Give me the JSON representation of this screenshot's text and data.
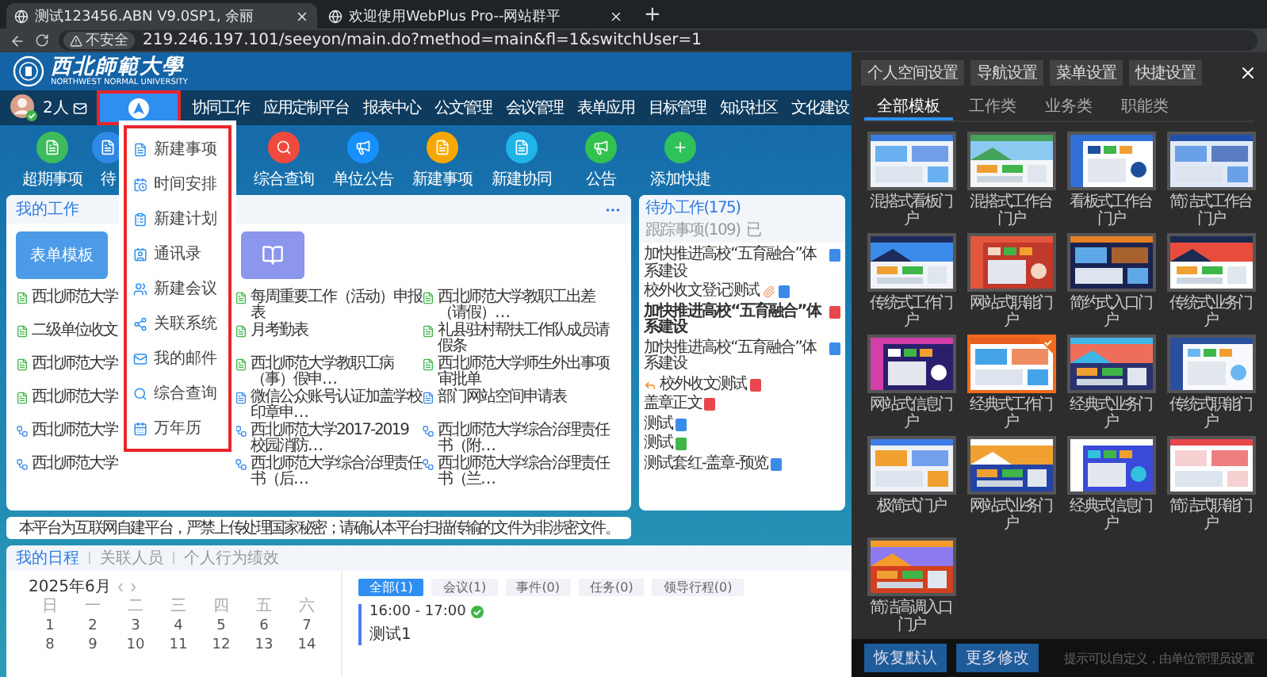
{
  "browser": {
    "tabs": [
      {
        "title": "测试123456.ABN V9.0SP1, 余丽",
        "selected": true
      },
      {
        "title": "欢迎使用WebPlus Pro--网站群平",
        "selected": false
      }
    ],
    "new_tab": "+",
    "security": "不安全",
    "url": "219.246.197.101/seeyon/main.do?method=main&fl=1&switchUser=1"
  },
  "header": {
    "logo_title": "西北師範大學",
    "logo_subtitle": "NORTHWEST NORMAL UNIVERSITY"
  },
  "user": {
    "online": "2人"
  },
  "nav": [
    {
      "kind": "home",
      "selected": true
    },
    {
      "kind": "text",
      "label": "协同工作",
      "selected": false
    },
    {
      "kind": "text",
      "label": "应用定制平台",
      "selected": false
    },
    {
      "kind": "text",
      "label": "报表中心",
      "selected": false
    },
    {
      "kind": "text",
      "label": "公文管理",
      "selected": false
    },
    {
      "kind": "text",
      "label": "会议管理",
      "selected": false
    },
    {
      "kind": "text",
      "label": "表单应用",
      "selected": false
    },
    {
      "kind": "text",
      "label": "目标管理",
      "selected": false
    },
    {
      "kind": "text",
      "label": "知识社区",
      "selected": false
    },
    {
      "kind": "text",
      "label": "文化建设",
      "selected": false
    }
  ],
  "dropdown": [
    {
      "label": "新建事项",
      "kind": "doc"
    },
    {
      "label": "时间安排",
      "kind": "schedule"
    },
    {
      "label": "新建计划",
      "kind": "plan"
    },
    {
      "label": "通讯录",
      "kind": "contacts"
    },
    {
      "label": "新建会议",
      "kind": "meeting"
    },
    {
      "label": "关联系统",
      "kind": "system"
    },
    {
      "label": "我的邮件",
      "kind": "mail"
    },
    {
      "label": "综合查询",
      "kind": "search"
    },
    {
      "label": "万年历",
      "kind": "calendar"
    }
  ],
  "shortcuts": [
    {
      "label": "超期事项",
      "color": "#3dbb5d",
      "kind": "doc"
    },
    {
      "label": "待",
      "color": "#2e8ae6",
      "kind": "doc"
    },
    {
      "label": "综合查询",
      "color": "#f04a3c",
      "kind": "search"
    },
    {
      "label": "单位公告",
      "color": "#1890ff",
      "kind": "speaker"
    },
    {
      "label": "新建事项",
      "color": "#f7a800",
      "kind": "doc"
    },
    {
      "label": "新建协同",
      "color": "#1fb5e8",
      "kind": "doc"
    },
    {
      "label": "公告",
      "color": "#33c24d",
      "kind": "speaker"
    },
    {
      "label": "添加快捷",
      "color": "#2fc25b",
      "kind": "plus"
    }
  ],
  "my_work": {
    "title": "我的工作",
    "template_tile": "表单模板",
    "columns": [
      [
        {
          "text": "西北师范大学",
          "kind": "form"
        },
        {
          "text": "二级单位收文",
          "kind": "form"
        },
        {
          "text": "西北师范大学",
          "kind": "form"
        },
        {
          "text": "西北师范大学",
          "kind": "form"
        },
        {
          "text": "西北师范大学",
          "kind": "flow"
        },
        {
          "text": "西北师范大学",
          "kind": "flow"
        }
      ],
      [
        {
          "text": "每周重要工作（活动）申报表",
          "kind": "form"
        },
        {
          "text": "月考勤表",
          "kind": "form"
        },
        {
          "text": "西北师范大学教职工病（事）假申…",
          "kind": "form"
        },
        {
          "text": "微信公众账号认证加盖学校印章申…",
          "kind": "doc"
        },
        {
          "text": "西北师范大学2017-2019校园消防…",
          "kind": "flow"
        },
        {
          "text": "西北师范大学综合治理责任书（后…",
          "kind": "flow"
        }
      ],
      [
        {
          "text": "西北师范大学教职工出差（请假）…",
          "kind": "form"
        },
        {
          "text": "礼县驻村帮扶工作队成员请假条",
          "kind": "form"
        },
        {
          "text": "西北师范大学师生外出事项审批单",
          "kind": "form"
        },
        {
          "text": "部门网站空间申请表",
          "kind": "doc"
        },
        {
          "text": "西北师范大学综合治理责任书（附…",
          "kind": "flow"
        },
        {
          "text": "西北师范大学综合治理责任书（兰…",
          "kind": "flow"
        }
      ]
    ]
  },
  "todo": {
    "tabs": [
      {
        "label": "待办工作(175)",
        "selected": true
      },
      {
        "label": "跟踪事项(109)",
        "selected": false
      },
      {
        "label": "已",
        "selected": false
      }
    ],
    "items": [
      {
        "text": "加快推进高校“五育融合”体系建设",
        "bold": false,
        "kind": "plain",
        "color": "#3b8beb"
      },
      {
        "text": "校外收文登记测试",
        "bold": false,
        "kind": "attachment",
        "color": "#3b8beb"
      },
      {
        "text": "加快推进高校“五育融合”体系建设",
        "bold": true,
        "kind": "plain",
        "color": "#e8474c"
      },
      {
        "text": "加快推进高校“五育融合”体系建设",
        "bold": false,
        "kind": "plain",
        "color": "#3b8beb"
      },
      {
        "text": "校外收文测试",
        "bold": false,
        "kind": "reply",
        "color": "#e8474c"
      },
      {
        "text": "盖章正文",
        "bold": false,
        "kind": "plain",
        "color": "#e8474c"
      },
      {
        "text": "测试",
        "bold": false,
        "kind": "plain",
        "color": "#3b8beb"
      },
      {
        "text": "测试",
        "bold": false,
        "kind": "plain",
        "color": "#3fb54a"
      },
      {
        "text": "测试套红-盖章-预览",
        "bold": false,
        "kind": "plain",
        "color": "#3b8beb"
      }
    ]
  },
  "notice": "本平台为互联网自建平台，严禁上传处理国家秘密；请确认本平台扫描传输的文件为非涉密文件。",
  "schedule": {
    "tabs": [
      {
        "label": "我的日程",
        "selected": true
      },
      {
        "label": "关联人员",
        "selected": false
      },
      {
        "label": "个人行为绩效",
        "selected": false
      }
    ],
    "month": "2025年6月",
    "weekdays": [
      "日",
      "一",
      "二",
      "三",
      "四",
      "五",
      "六"
    ],
    "weeks": [
      [
        "1",
        "2",
        "3",
        "4",
        "5",
        "6",
        "7"
      ],
      [
        "8",
        "9",
        "10",
        "11",
        "12",
        "13",
        "14"
      ]
    ],
    "filters": [
      {
        "label": "全部(1)",
        "selected": true
      },
      {
        "label": "会议(1)",
        "selected": false
      },
      {
        "label": "事件(0)",
        "selected": false
      },
      {
        "label": "任务(0)",
        "selected": false
      },
      {
        "label": "领导行程(0)",
        "selected": false
      }
    ],
    "events": [
      {
        "time": "16:00 - 17:00",
        "done": true,
        "title": "测试1"
      }
    ]
  },
  "drawer": {
    "settings": [
      "个人空间设置",
      "导航设置",
      "菜单设置",
      "快捷设置"
    ],
    "tabs": [
      {
        "label": "全部模板",
        "selected": true
      },
      {
        "label": "工作类",
        "selected": false
      },
      {
        "label": "业务类",
        "selected": false
      },
      {
        "label": "职能类",
        "selected": false
      }
    ],
    "portals": [
      {
        "label": "混搭式看板门户",
        "selected": false
      },
      {
        "label": "混搭式工作台门户",
        "selected": false
      },
      {
        "label": "看板式工作台门户",
        "selected": false
      },
      {
        "label": "简洁式工作台门户",
        "selected": false
      },
      {
        "label": "传统式工作门户",
        "selected": false
      },
      {
        "label": "网站式职能门户",
        "selected": false
      },
      {
        "label": "简约式入口门户",
        "selected": false
      },
      {
        "label": "传统式业务门户",
        "selected": false
      },
      {
        "label": "网站式信息门户",
        "selected": false
      },
      {
        "label": "经典式工作门户",
        "selected": true
      },
      {
        "label": "经典式业务门户",
        "selected": false
      },
      {
        "label": "传统式职能门户",
        "selected": false
      },
      {
        "label": "极简式门户",
        "selected": false
      },
      {
        "label": "网站式业务门户",
        "selected": false
      },
      {
        "label": "经典式信息门户",
        "selected": false
      },
      {
        "label": "简洁式职能门户",
        "selected": false
      },
      {
        "label": "简洁高调入口门户",
        "selected": false
      }
    ],
    "footer_buttons": [
      "恢复默认",
      "更多修改"
    ],
    "hint": "提示可以自定义，由单位管理员设置"
  }
}
